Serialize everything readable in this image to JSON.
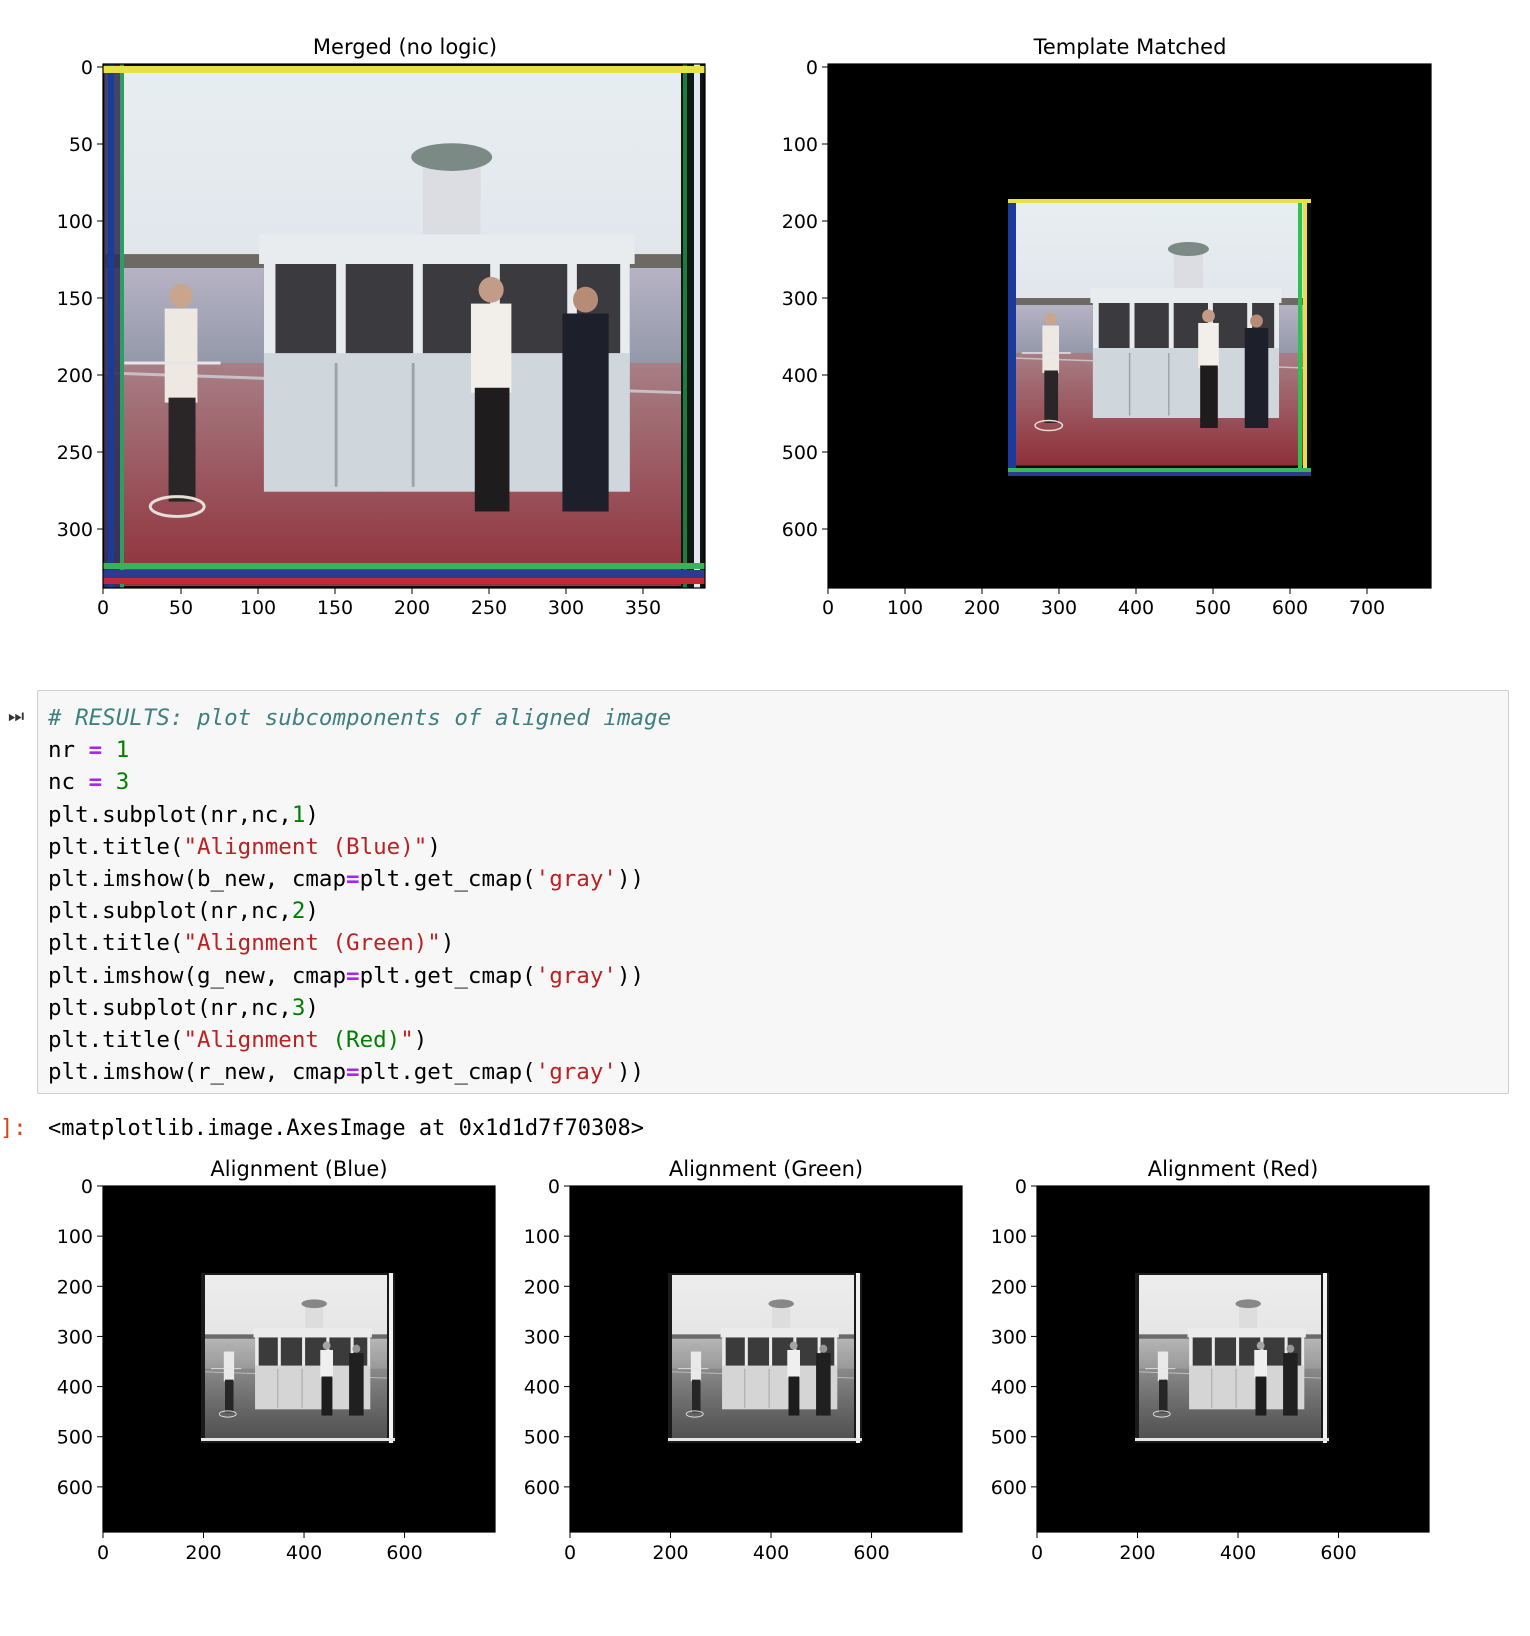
{
  "colors": {
    "comment": "#408080",
    "operator": "#aa22ff",
    "number": "#008000",
    "string": "#ba2121",
    "out_prompt": "#d84315",
    "cell_bg": "#f7f7f7"
  },
  "icons": {
    "run": "run-step-icon"
  },
  "top_figure": {
    "merged": {
      "title": "Merged (no logic)",
      "xticks": [
        "0",
        "50",
        "100",
        "150",
        "200",
        "250",
        "300",
        "350"
      ],
      "yticks": [
        "0",
        "50",
        "100",
        "150",
        "200",
        "250",
        "300"
      ]
    },
    "matched": {
      "title": "Template Matched",
      "xticks": [
        "0",
        "100",
        "200",
        "300",
        "400",
        "500",
        "600",
        "700"
      ],
      "yticks": [
        "0",
        "100",
        "200",
        "300",
        "400",
        "500",
        "600"
      ]
    }
  },
  "cell": {
    "run_glyph": "⏭",
    "lines": [
      [
        {
          "c": "cm",
          "t": "# RESULTS: plot subcomponents of aligned image"
        }
      ],
      [
        {
          "t": "nr "
        },
        {
          "c": "op",
          "t": "="
        },
        {
          "t": " "
        },
        {
          "c": "num",
          "t": "1"
        }
      ],
      [
        {
          "t": "nc "
        },
        {
          "c": "op",
          "t": "="
        },
        {
          "t": " "
        },
        {
          "c": "num",
          "t": "3"
        }
      ],
      [
        {
          "t": "plt.subplot(nr,nc,"
        },
        {
          "c": "num",
          "t": "1"
        },
        {
          "t": ")"
        }
      ],
      [
        {
          "t": "plt.title("
        },
        {
          "c": "str",
          "t": "\"Alignment (Blue)\""
        },
        {
          "t": ")"
        }
      ],
      [
        {
          "t": "plt.imshow(b_new, cmap"
        },
        {
          "c": "op",
          "t": "="
        },
        {
          "t": "plt.get_cmap("
        },
        {
          "c": "str",
          "t": "'gray'"
        },
        {
          "t": "))"
        }
      ],
      [
        {
          "t": "plt.subplot(nr,nc,"
        },
        {
          "c": "num",
          "t": "2"
        },
        {
          "t": ")"
        }
      ],
      [
        {
          "t": "plt.title("
        },
        {
          "c": "str",
          "t": "\"Alignment (Green)\""
        },
        {
          "t": ")"
        }
      ],
      [
        {
          "t": "plt.imshow(g_new, cmap"
        },
        {
          "c": "op",
          "t": "="
        },
        {
          "t": "plt.get_cmap("
        },
        {
          "c": "str",
          "t": "'gray'"
        },
        {
          "t": "))"
        }
      ],
      [
        {
          "t": "plt.subplot(nr,nc,"
        },
        {
          "c": "num",
          "t": "3"
        },
        {
          "t": ")"
        }
      ],
      [
        {
          "t": "plt.title("
        },
        {
          "c": "str",
          "t": "\"Alignment "
        },
        {
          "c": "num",
          "t": "(Red)"
        },
        {
          "c": "str",
          "t": "\""
        },
        {
          "t": ")"
        }
      ],
      [
        {
          "t": "plt.imshow(r_new, cmap"
        },
        {
          "c": "op",
          "t": "="
        },
        {
          "t": "plt.get_cmap("
        },
        {
          "c": "str",
          "t": "'gray'"
        },
        {
          "t": "))"
        }
      ]
    ]
  },
  "output": {
    "prompt": "]:",
    "text": "<matplotlib.image.AxesImage at 0x1d1d7f70308>"
  },
  "bottom_figure": {
    "panels": [
      {
        "title": "Alignment (Blue)",
        "xticks": [
          "0",
          "200",
          "400",
          "600"
        ],
        "yticks": [
          "0",
          "100",
          "200",
          "300",
          "400",
          "500",
          "600"
        ]
      },
      {
        "title": "Alignment (Green)",
        "xticks": [
          "0",
          "200",
          "400",
          "600"
        ],
        "yticks": [
          "0",
          "100",
          "200",
          "300",
          "400",
          "500",
          "600"
        ]
      },
      {
        "title": "Alignment (Red)",
        "xticks": [
          "0",
          "200",
          "400",
          "600"
        ],
        "yticks": [
          "0",
          "100",
          "200",
          "300",
          "400",
          "500",
          "600"
        ]
      }
    ]
  }
}
